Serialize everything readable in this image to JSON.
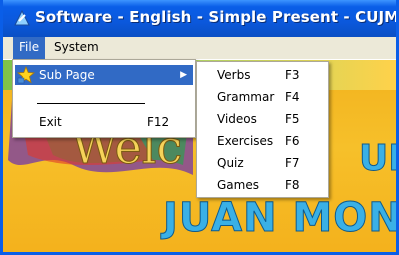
{
  "window": {
    "title": "Software - English - Simple Present - CUJM"
  },
  "menubar": {
    "items": [
      {
        "label": "File"
      },
      {
        "label": "System"
      }
    ]
  },
  "file_menu": {
    "items": [
      {
        "label": "Sub Page",
        "icon": "star-icon",
        "has_submenu": true
      },
      {
        "label": "Exit",
        "shortcut": "F12"
      }
    ]
  },
  "sub_menu": {
    "items": [
      {
        "label": "Verbs",
        "shortcut": "F3"
      },
      {
        "label": "Grammar",
        "shortcut": "F4"
      },
      {
        "label": "Videos",
        "shortcut": "F5"
      },
      {
        "label": "Exercises",
        "shortcut": "F6"
      },
      {
        "label": "Quiz",
        "shortcut": "F7"
      },
      {
        "label": "Games",
        "shortcut": "F8"
      }
    ]
  },
  "background": {
    "welcome_text": "Welc",
    "right_text": "UI",
    "bottom_text": "JUAN MON"
  },
  "colors": {
    "titlebar": "#0a5ee8",
    "highlight": "#316ac5",
    "menu_bg": "#ece9d8",
    "content_bg": "#f4b11c"
  }
}
